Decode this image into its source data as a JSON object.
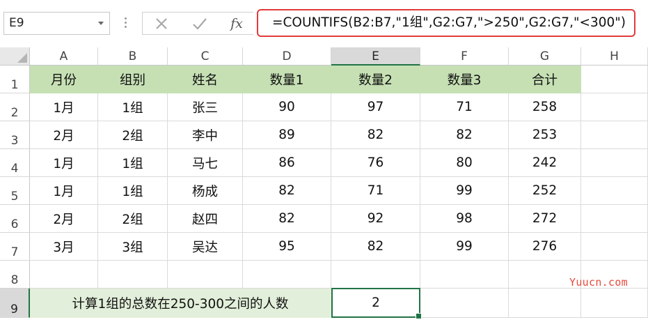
{
  "formula_bar": {
    "name_box": "E9",
    "formula": "=COUNTIFS(B2:B7,\"1组\",G2:G7,\">250\",G2:G7,\"<300\")",
    "icons": [
      "cancel-x-icon",
      "confirm-check-icon",
      "fx-icon"
    ],
    "fx_label": "fx",
    "highlight_color": "#e23a3a"
  },
  "columns": [
    "A",
    "B",
    "C",
    "D",
    "E",
    "F",
    "G",
    "H"
  ],
  "rows": [
    "1",
    "2",
    "3",
    "4",
    "5",
    "6",
    "7",
    "8",
    "9"
  ],
  "sheet": {
    "header": [
      "月份",
      "组别",
      "姓名",
      "数量1",
      "数量2",
      "数量3",
      "合计"
    ],
    "data": [
      [
        "1月",
        "1组",
        "张三",
        "90",
        "97",
        "71",
        "258"
      ],
      [
        "2月",
        "2组",
        "李中",
        "89",
        "82",
        "82",
        "253"
      ],
      [
        "1月",
        "1组",
        "马七",
        "86",
        "76",
        "80",
        "242"
      ],
      [
        "1月",
        "1组",
        "杨成",
        "82",
        "71",
        "99",
        "252"
      ],
      [
        "2月",
        "2组",
        "赵四",
        "82",
        "92",
        "98",
        "272"
      ],
      [
        "3月",
        "3组",
        "吴达",
        "95",
        "82",
        "99",
        "276"
      ]
    ],
    "note": "计算1组的总数在250-300之间的人数",
    "result": "2",
    "header_fill": "#c6e0b4",
    "note_fill": "#e2efda",
    "selection_color": "#217346"
  },
  "selected_column": "E",
  "selected_row": "9",
  "watermark": "Yuucn.com"
}
